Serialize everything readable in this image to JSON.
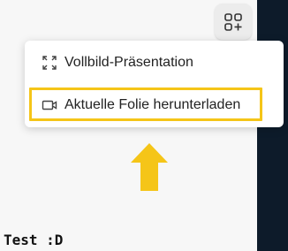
{
  "toolbar": {
    "apps_button_icon": "grid-plus-icon"
  },
  "menu": {
    "items": [
      {
        "label": "Vollbild-Präsentation",
        "icon": "fullscreen-icon"
      },
      {
        "label": "Aktuelle Folie herunterladen",
        "icon": "video-icon"
      }
    ]
  },
  "annotation": {
    "caption": "Test :D",
    "highlight_color": "#f5c518",
    "arrow_color": "#f5c518"
  },
  "colors": {
    "sidebar": "#0d1b2a",
    "background": "#f7f7f7"
  }
}
